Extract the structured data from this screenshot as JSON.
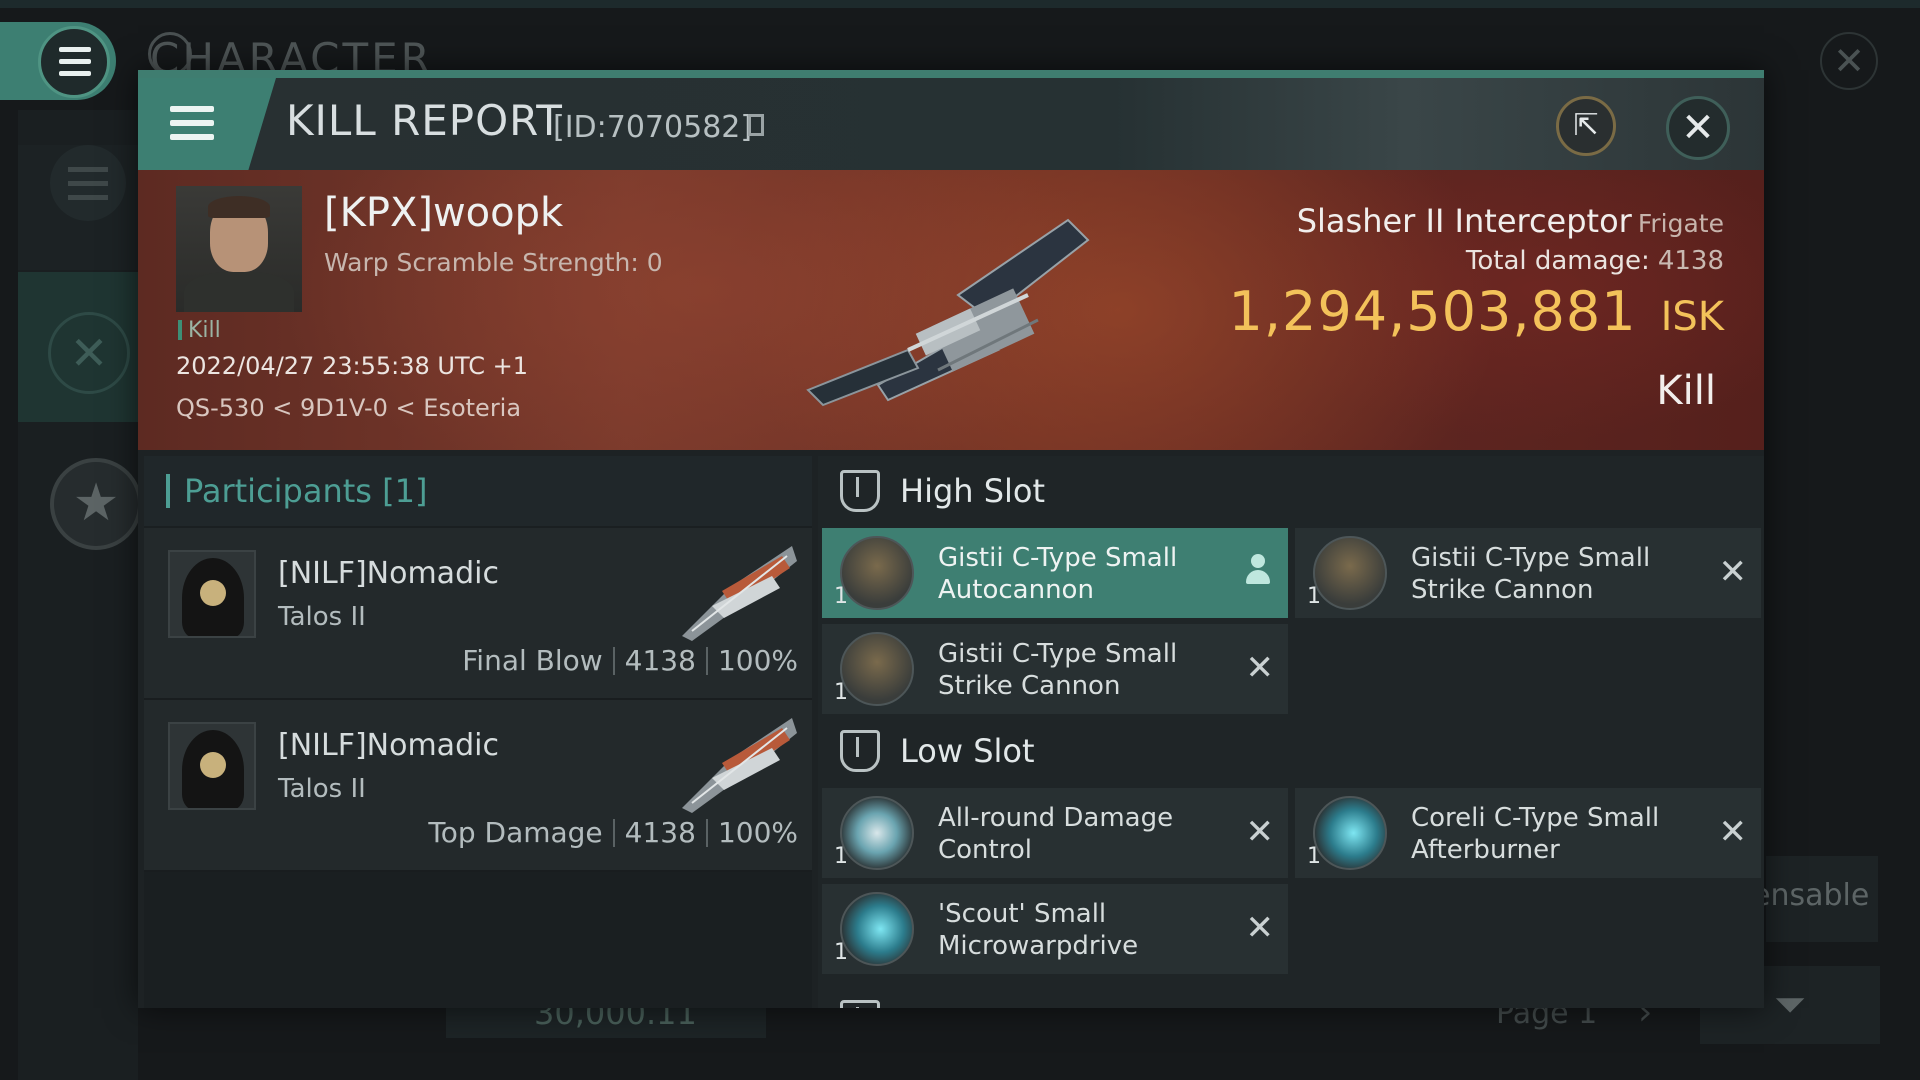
{
  "background": {
    "title": "CHARACTER",
    "bottom_value": "30,000.11",
    "page_label": "Page 1",
    "right_text": "ensable"
  },
  "dialog": {
    "title": "KILL REPORT",
    "report_id": "[ID:7070582]"
  },
  "victim": {
    "name": "[KPX]woopk",
    "warp_scramble": "Warp Scramble Strength: 0",
    "tag": "Kill",
    "timestamp": "2022/04/27 23:55:38 UTC +1",
    "location": "QS-530 < 9D1V-0 < Esoteria",
    "ship_name": "Slasher II Interceptor",
    "ship_class": "Frigate",
    "total_damage_label": "Total damage:",
    "total_damage": "4138",
    "isk_value": "1,294,503,881",
    "isk_unit": "ISK",
    "result": "Kill"
  },
  "participants": {
    "header": "Participants [1]",
    "rows": [
      {
        "name": "[NILF]Nomadic",
        "ship": "Talos II",
        "role": "Final Blow",
        "damage": "4138",
        "percent": "100%"
      },
      {
        "name": "[NILF]Nomadic",
        "ship": "Talos II",
        "role": "Top Damage",
        "damage": "4138",
        "percent": "100%"
      }
    ]
  },
  "fitting": {
    "high_slot_label": "High Slot",
    "low_slot_label": "Low Slot",
    "high": [
      {
        "line1": "Gistii C-Type Small",
        "line2": "Autocannon",
        "qty": "1",
        "icon": "autocannon-icon"
      },
      {
        "line1": "Gistii C-Type Small",
        "line2": "Strike Cannon",
        "qty": "1",
        "icon": "strike-cannon-icon"
      },
      {
        "line1": "Gistii C-Type Small",
        "line2": "Strike Cannon",
        "qty": "1",
        "icon": "strike-cannon-icon"
      }
    ],
    "low": [
      {
        "line1": "All-round Damage",
        "line2": "Control",
        "qty": "1",
        "icon": "damage-control-icon"
      },
      {
        "line1": "Coreli C-Type Small",
        "line2": "Afterburner",
        "qty": "1",
        "icon": "afterburner-icon"
      },
      {
        "line1": "'Scout' Small",
        "line2": "Microwarpdrive",
        "qty": "1",
        "icon": "microwarpdrive-icon"
      }
    ]
  },
  "icons": {
    "close": "✕",
    "share": "⇱",
    "remove": "✕",
    "star": "★",
    "swords": "✕"
  }
}
